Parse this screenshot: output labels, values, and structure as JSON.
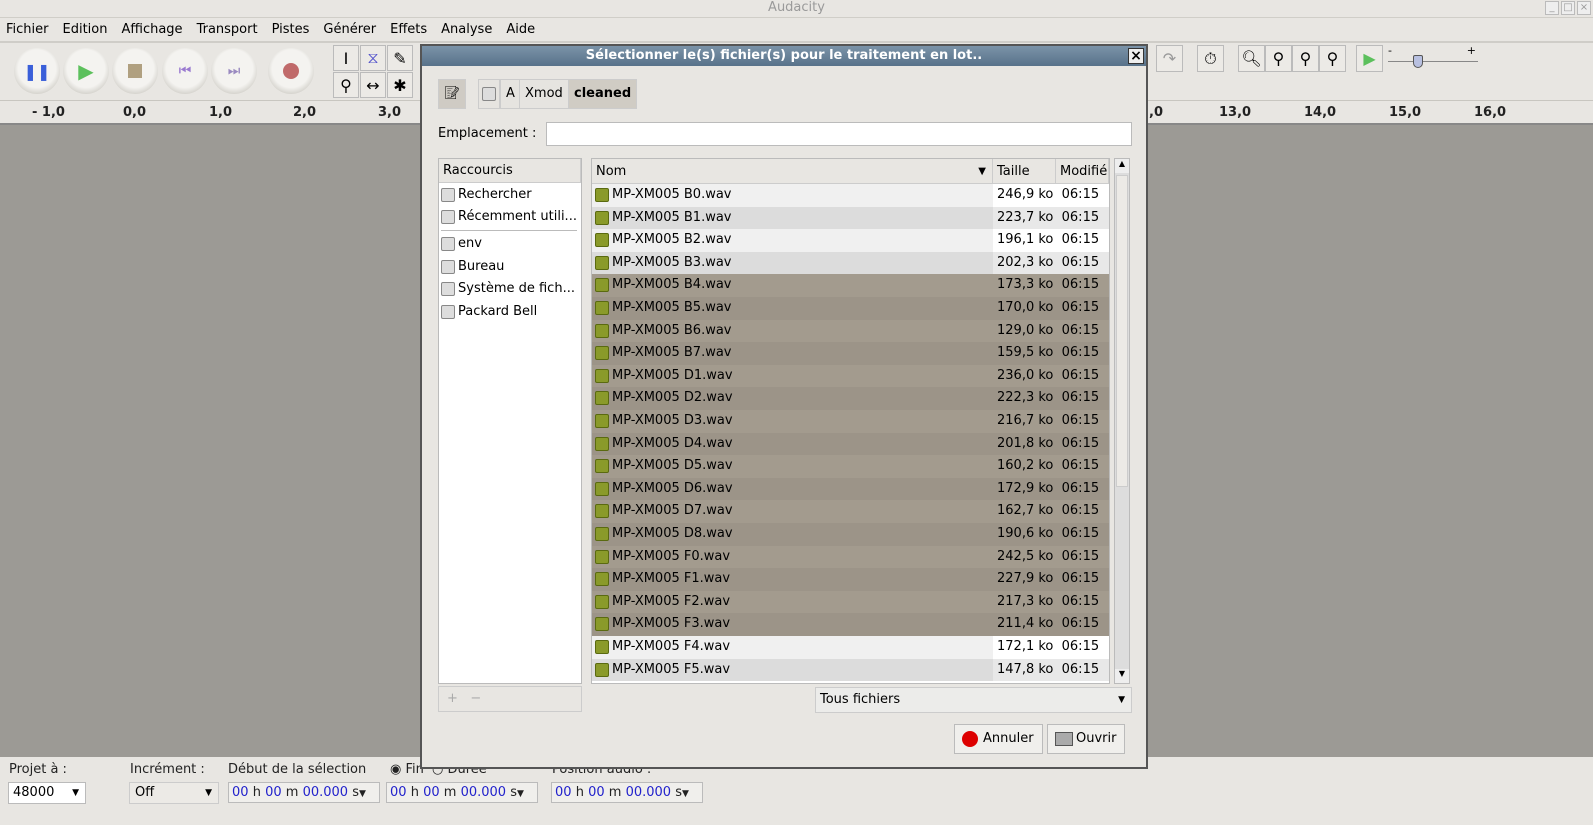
{
  "app": {
    "title": "Audacity"
  },
  "menu": [
    "Fichier",
    "Edition",
    "Affichage",
    "Transport",
    "Pistes",
    "Générer",
    "Effets",
    "Analyse",
    "Aide"
  ],
  "transport_icons": [
    "pause-icon",
    "play-icon",
    "stop-icon",
    "skip-start-icon",
    "skip-end-icon",
    "record-icon"
  ],
  "ruler": [
    "- 1,0",
    "0,0",
    "1,0",
    "2,0",
    "3,0",
    "2,0",
    "13,0",
    "14,0",
    "15,0",
    "16,0"
  ],
  "playback_speed": {
    "min_label": "-",
    "max_label": "+",
    "value": 0.33
  },
  "bottom": {
    "project_rate_label": "Projet à :",
    "project_rate": "48000",
    "snap_label": "Incrément :",
    "snap": "Off",
    "sel_start_label": "Début de la sélection",
    "end_label": "Fin",
    "duration_label": "Durée",
    "audio_pos_label": "Position audio :",
    "time": {
      "h": "00",
      "m": "00",
      "s": "00.000",
      "hu": "h",
      "mu": "m",
      "su": "s"
    }
  },
  "dialog": {
    "title": "Sélectionner le(s) fichier(s) pour le traitement en lot..",
    "path": [
      "A",
      "Xmod",
      "cleaned"
    ],
    "location_label": "Emplacement :",
    "location_value": "",
    "shortcuts_header": "Raccourcis",
    "shortcuts": [
      "Rechercher",
      "Récemment utili...",
      "env",
      "Bureau",
      "Système de fich...",
      "Packard Bell"
    ],
    "columns": [
      "Nom",
      "Taille",
      "Modifié"
    ],
    "files": [
      [
        "MP-XM005 B0.wav",
        "246,9 ko",
        "06:15"
      ],
      [
        "MP-XM005 B1.wav",
        "223,7 ko",
        "06:15"
      ],
      [
        "MP-XM005 B2.wav",
        "196,1 ko",
        "06:15"
      ],
      [
        "MP-XM005 B3.wav",
        "202,3 ko",
        "06:15"
      ],
      [
        "MP-XM005 B4.wav",
        "173,3 ko",
        "06:15"
      ],
      [
        "MP-XM005 B5.wav",
        "170,0 ko",
        "06:15"
      ],
      [
        "MP-XM005 B6.wav",
        "129,0 ko",
        "06:15"
      ],
      [
        "MP-XM005 B7.wav",
        "159,5 ko",
        "06:15"
      ],
      [
        "MP-XM005 D1.wav",
        "236,0 ko",
        "06:15"
      ],
      [
        "MP-XM005 D2.wav",
        "222,3 ko",
        "06:15"
      ],
      [
        "MP-XM005 D3.wav",
        "216,7 ko",
        "06:15"
      ],
      [
        "MP-XM005 D4.wav",
        "201,8 ko",
        "06:15"
      ],
      [
        "MP-XM005 D5.wav",
        "160,2 ko",
        "06:15"
      ],
      [
        "MP-XM005 D6.wav",
        "172,9 ko",
        "06:15"
      ],
      [
        "MP-XM005 D7.wav",
        "162,7 ko",
        "06:15"
      ],
      [
        "MP-XM005 D8.wav",
        "190,6 ko",
        "06:15"
      ],
      [
        "MP-XM005 F0.wav",
        "242,5 ko",
        "06:15"
      ],
      [
        "MP-XM005 F1.wav",
        "227,9 ko",
        "06:15"
      ],
      [
        "MP-XM005 F2.wav",
        "217,3 ko",
        "06:15"
      ],
      [
        "MP-XM005 F3.wav",
        "211,4 ko",
        "06:15"
      ],
      [
        "MP-XM005 F4.wav",
        "172,1 ko",
        "06:15"
      ],
      [
        "MP-XM005 F5.wav",
        "147,8 ko",
        "06:15"
      ]
    ],
    "selected_range": [
      4,
      19
    ],
    "filter": "Tous fichiers",
    "cancel": "Annuler",
    "open": "Ouvrir"
  },
  "colors": {
    "selected": "#a39b8e",
    "selected_alt": "#9c9488",
    "title_bar": "#6a8299"
  }
}
